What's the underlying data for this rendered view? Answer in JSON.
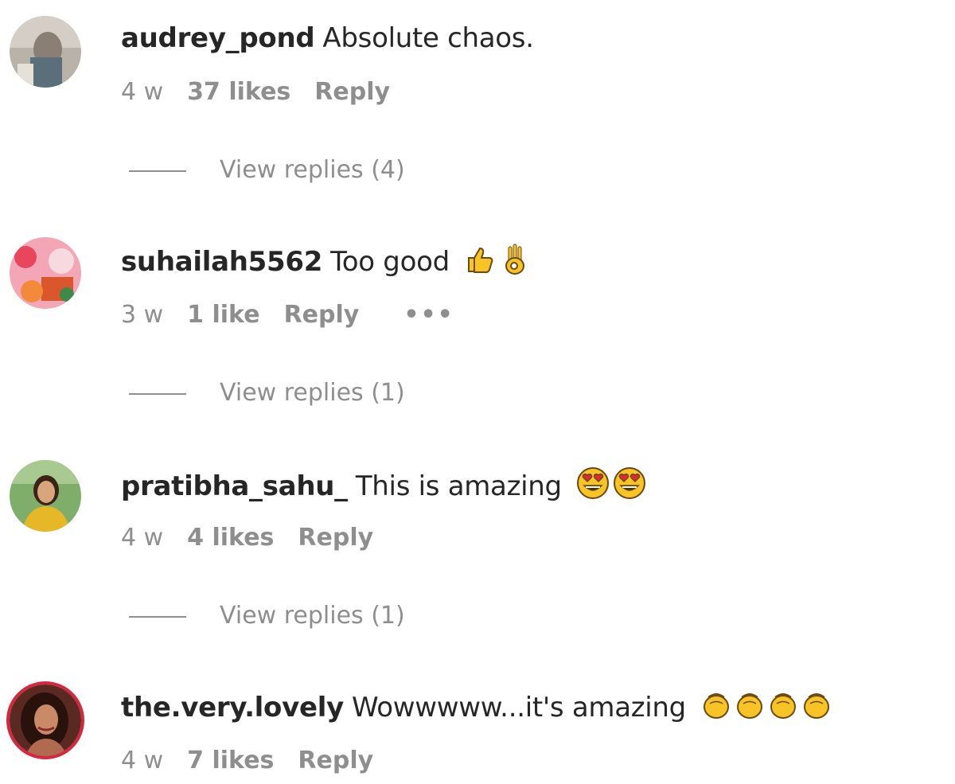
{
  "comments": [
    {
      "username": "audrey_pond",
      "text": "Absolute chaos.",
      "time": "4 w",
      "likes": "37 likes",
      "reply": "Reply",
      "more": "",
      "view_replies": "View replies (4)",
      "emojis": []
    },
    {
      "username": "suhailah5562",
      "text": "Too good",
      "time": "3 w",
      "likes": "1 like",
      "reply": "Reply",
      "more": "•••",
      "view_replies": "View replies (1)",
      "emojis": [
        "thumbs-up-icon",
        "ok-hand-icon"
      ]
    },
    {
      "username": "pratibha_sahu_",
      "text": "This is amazing",
      "time": "4 w",
      "likes": "4 likes",
      "reply": "Reply",
      "more": "",
      "view_replies": "View replies (1)",
      "emojis": [
        "heart-eyes-icon",
        "heart-eyes-icon"
      ]
    },
    {
      "username": "the.very.lovely",
      "text": "Wowwwww...it's amazing",
      "time": "4 w",
      "likes": "7 likes",
      "reply": "Reply",
      "more": "",
      "view_replies": "",
      "emojis": [
        "clap-icon",
        "clap-icon",
        "clap-icon",
        "clap-icon"
      ]
    }
  ],
  "colors": {
    "text": "#262626",
    "muted": "#8e8e8e",
    "emoji_yellow": "#f7c325",
    "ring": "#d7263d"
  }
}
